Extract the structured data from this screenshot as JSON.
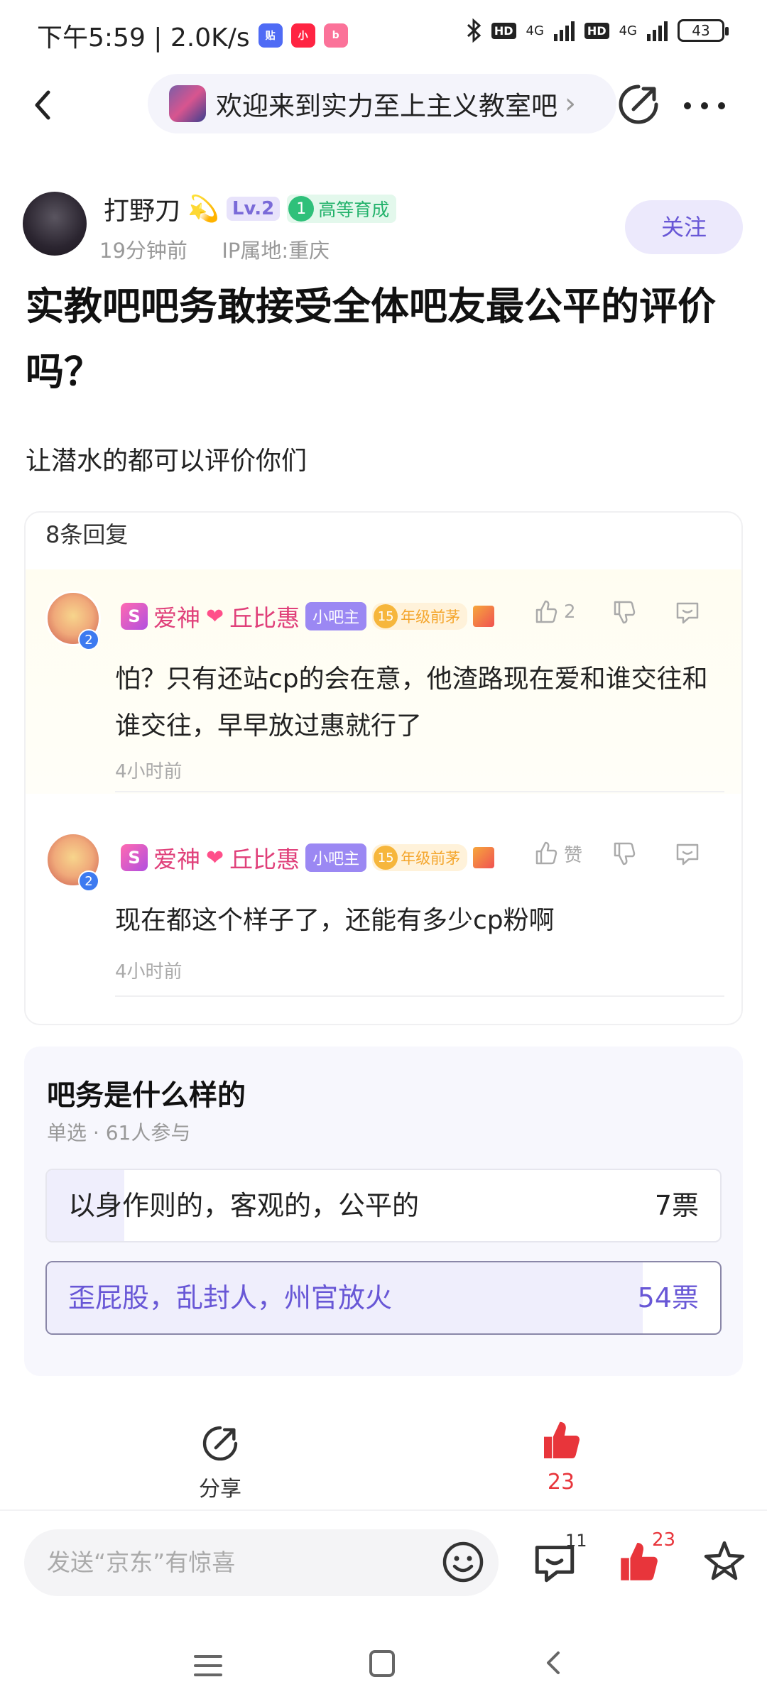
{
  "status_bar": {
    "time_speed": "下午5:59 | 2.0K/s",
    "app_icons": [
      "tieba-icon",
      "xiaohongshu-icon",
      "bilibili-icon"
    ],
    "network_1": "4G",
    "network_2": "4G",
    "hd_1": "HD",
    "hd_2": "HD",
    "battery": "43"
  },
  "nav": {
    "forum_name": "欢迎来到实力至上主义教室吧",
    "forum_arrow": "›"
  },
  "author": {
    "name": "打野刀",
    "emoji": "💫",
    "level": "Lv.2",
    "badge_num": "1",
    "badge_label": "高等育成",
    "time": "19分钟前",
    "ip": "IP属地:重庆",
    "follow_label": "关注"
  },
  "post": {
    "title": "实教吧吧务敢接受全体吧友最公平的评价吗？",
    "body": "让潜水的都可以评价你们"
  },
  "replies": {
    "count_label": "8条回复",
    "items": [
      {
        "s_icon": "S",
        "name_a": "爱神",
        "name_b": "丘比惠",
        "role_tag": "小吧主",
        "grade_num": "15",
        "grade_label": "年级前茅",
        "like_label": "2",
        "text": "怕？只有还站cp的会在意，他渣路现在爱和谁交往和谁交往，早早放过惠就行了",
        "time": "4小时前",
        "badge": "2"
      },
      {
        "s_icon": "S",
        "name_a": "爱神",
        "name_b": "丘比惠",
        "role_tag": "小吧主",
        "grade_num": "15",
        "grade_label": "年级前茅",
        "like_label": "赞",
        "text": "现在都这个样子了，还能有多少cp粉啊",
        "time": "4小时前",
        "badge": "2"
      }
    ]
  },
  "poll": {
    "title": "吧务是什么样的",
    "meta": "单选 · 61人参与",
    "options": [
      {
        "label": "以身作则的，客观的，公平的",
        "votes": "7票",
        "share": 0.115
      },
      {
        "label": "歪屁股，乱封人，州官放火",
        "votes": "54票",
        "share": 0.885
      }
    ]
  },
  "actions": {
    "share_label": "分享",
    "like_count": "23"
  },
  "input_bar": {
    "placeholder": "发送“京东”有惊喜",
    "comment_count": "11",
    "like_count": "23"
  },
  "colors": {
    "accent": "#6857d6",
    "like_red": "#e8353b",
    "name_pink": "#e0407a"
  }
}
